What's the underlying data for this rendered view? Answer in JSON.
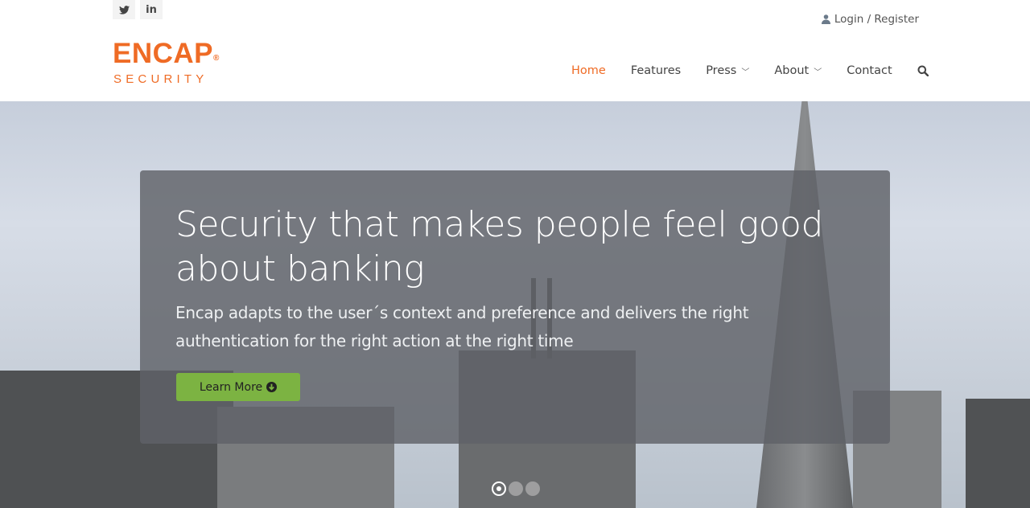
{
  "social": [
    {
      "name": "twitter",
      "glyph": "🐦"
    },
    {
      "name": "linkedin",
      "glyph": "in"
    }
  ],
  "header": {
    "login_label": "Login / Register",
    "logo_main": "ENCAP",
    "logo_reg": "®",
    "logo_sub": "SECURITY"
  },
  "nav": {
    "items": [
      {
        "label": "Home",
        "active": true
      },
      {
        "label": "Features"
      },
      {
        "label": "Press",
        "dropdown": true
      },
      {
        "label": "About",
        "dropdown": true
      },
      {
        "label": "Contact"
      }
    ],
    "chevron": "⌄",
    "search_icon": "search-icon"
  },
  "hero": {
    "title": "Security that makes people feel good about banking",
    "subtitle": "Encap adapts to the user´s context and preference and delivers the right authentication for the right action at the right time",
    "button_label": "Learn More",
    "slides": 3,
    "active_slide": 1,
    "colors": {
      "accent": "#ef6b25",
      "button": "#7cb342"
    }
  }
}
